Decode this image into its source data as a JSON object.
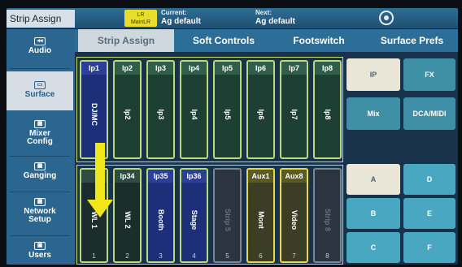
{
  "header": {
    "app_title": "Strip Assign",
    "badge_line1": "LR",
    "badge_line2": "MainLR",
    "current_label": "Current:",
    "current_value": "Ag default",
    "next_label": "Next:",
    "next_value": "Ag default",
    "scene_icon": "scene-icon"
  },
  "sidebar": {
    "items": [
      {
        "label": "Audio",
        "icon": "◂◂"
      },
      {
        "label": "Surface",
        "icon": "▭"
      },
      {
        "label": "Mixer Config",
        "icon": "▦"
      },
      {
        "label": "Ganging",
        "icon": "▦"
      },
      {
        "label": "Network Setup",
        "icon": "▦"
      },
      {
        "label": "Users",
        "icon": "▣"
      }
    ]
  },
  "tabs": [
    "Strip Assign",
    "Soft Controls",
    "Footswitch",
    "Surface Prefs"
  ],
  "strips_row1": [
    {
      "top": "Ip1",
      "name": "DJ/MC",
      "color": "blue"
    },
    {
      "top": "Ip2",
      "name": "Ip2",
      "color": "green"
    },
    {
      "top": "Ip3",
      "name": "Ip3",
      "color": "green"
    },
    {
      "top": "Ip4",
      "name": "Ip4",
      "color": "green"
    },
    {
      "top": "Ip5",
      "name": "Ip5",
      "color": "green"
    },
    {
      "top": "Ip6",
      "name": "Ip6",
      "color": "green"
    },
    {
      "top": "Ip7",
      "name": "Ip7",
      "color": "green"
    },
    {
      "top": "Ip8",
      "name": "Ip8",
      "color": "green"
    }
  ],
  "strips_row2": [
    {
      "top": "",
      "name": "WL 1",
      "num": "1",
      "color": "dark"
    },
    {
      "top": "Ip34",
      "name": "WL 2",
      "num": "2",
      "color": "dark"
    },
    {
      "top": "Ip35",
      "name": "Booth",
      "num": "3",
      "color": "blue"
    },
    {
      "top": "Ip36",
      "name": "Stage",
      "num": "4",
      "color": "blue"
    },
    {
      "top": "",
      "name": "Strip 5",
      "num": "5",
      "color": "gray"
    },
    {
      "top": "Aux1",
      "name": "Mont",
      "num": "6",
      "color": "yellow"
    },
    {
      "top": "Aux8",
      "name": "Video",
      "num": "7",
      "color": "yellow"
    },
    {
      "top": "",
      "name": "Strip 8",
      "num": "8",
      "color": "gray"
    }
  ],
  "right_buttons": {
    "ip": "IP",
    "fx": "FX",
    "mix": "Mix",
    "dca_midi": "DCA/MIDI",
    "a": "A",
    "b": "B",
    "c": "C",
    "d": "D",
    "e": "E",
    "f": "F"
  },
  "colors": {
    "arrow": "#f2e519",
    "strip_border": "#b9d97a",
    "badge": "#e8dd2b"
  }
}
